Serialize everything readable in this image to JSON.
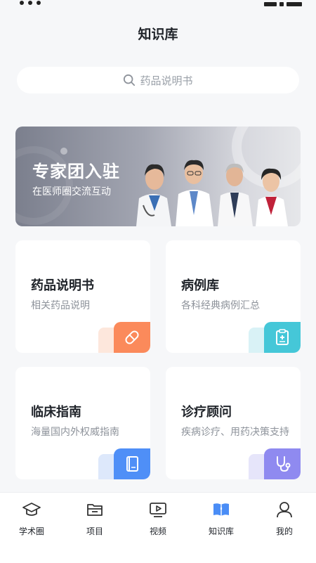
{
  "header": {
    "title": "知识库"
  },
  "search": {
    "placeholder": "药品说明书"
  },
  "banner": {
    "title": "专家团入驻",
    "subtitle": "在医师圈交流互动"
  },
  "cards": [
    {
      "title": "药品说明书",
      "desc": "相关药品说明",
      "icon": "pill-icon",
      "color": "#fb8a5b"
    },
    {
      "title": "病例库",
      "desc": "各科经典病例汇总",
      "icon": "clipboard-icon",
      "color": "#45c7d8"
    },
    {
      "title": "临床指南",
      "desc": "海量国内外权威指南",
      "icon": "book-icon",
      "color": "#4f8ff7"
    },
    {
      "title": "诊疗顾问",
      "desc": "疾病诊疗、用药决策支持",
      "icon": "stethoscope-icon",
      "color": "#8f8af0"
    }
  ],
  "tabbar": {
    "active": "知识库",
    "items": [
      {
        "label": "学术圈",
        "icon": "graduation-cap-icon"
      },
      {
        "label": "项目",
        "icon": "folder-icon"
      },
      {
        "label": "视频",
        "icon": "video-play-icon"
      },
      {
        "label": "知识库",
        "icon": "open-book-icon"
      },
      {
        "label": "我的",
        "icon": "user-icon"
      }
    ]
  },
  "colors": {
    "accent": "#4a8df6",
    "background": "#f6f7f9"
  }
}
